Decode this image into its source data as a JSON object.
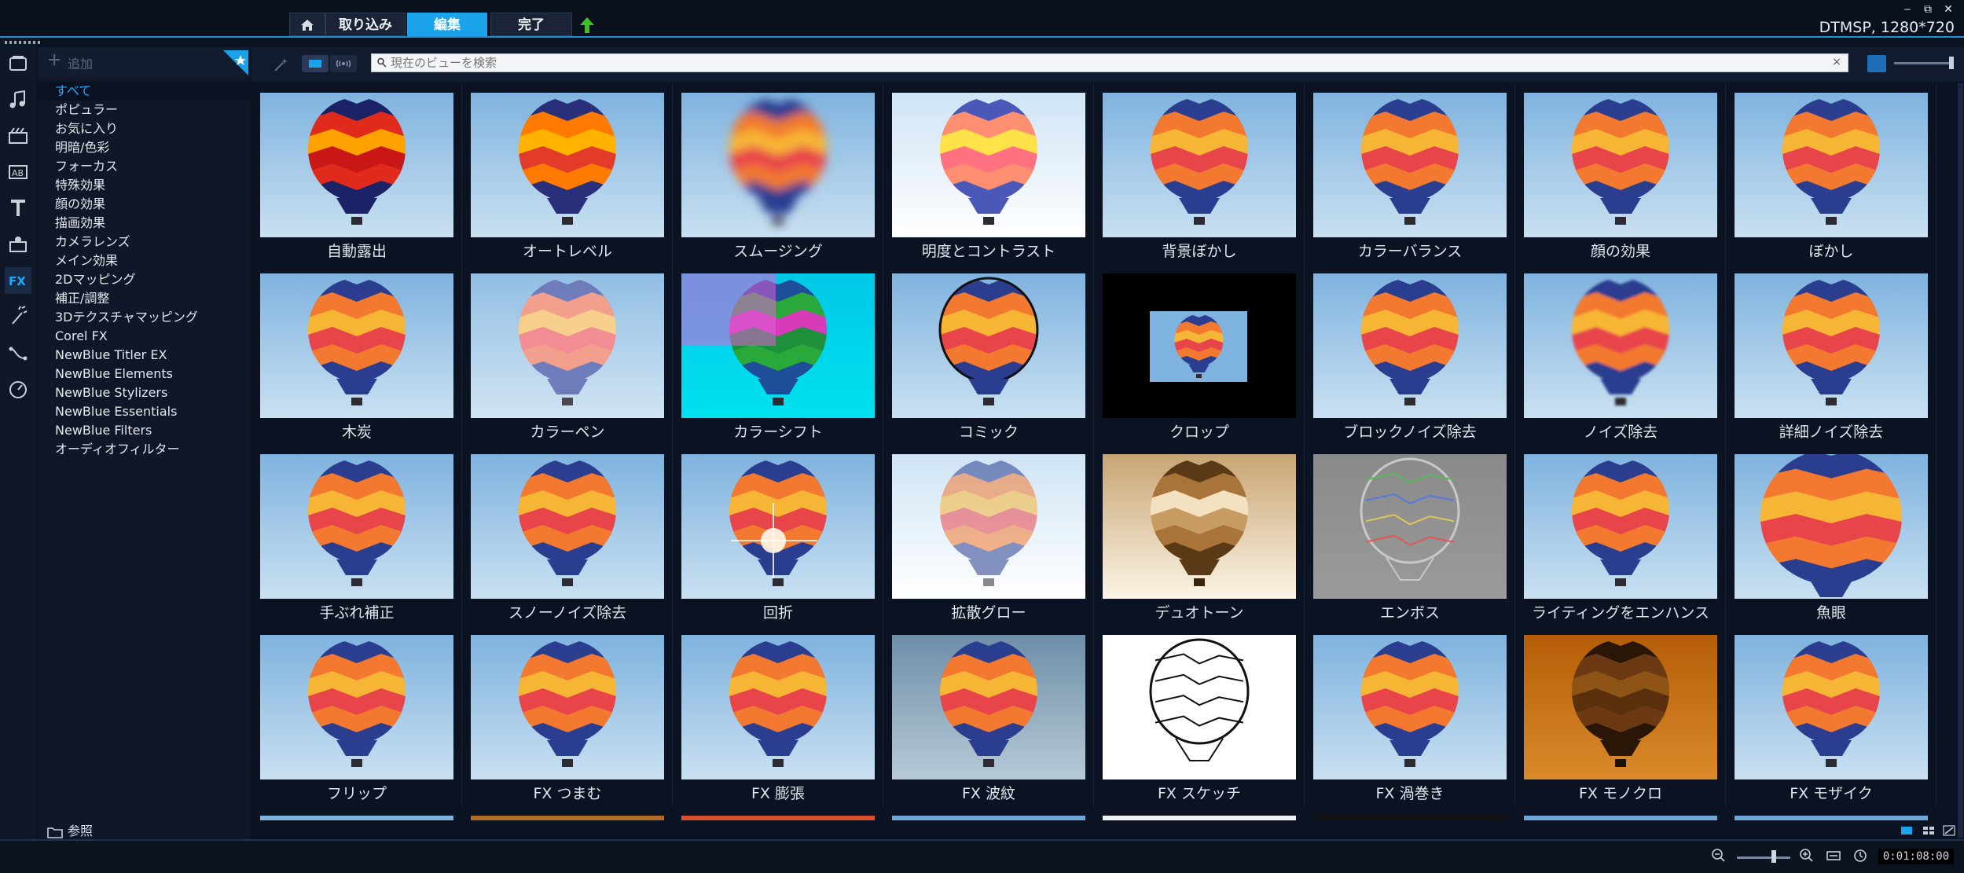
{
  "titlebar": {
    "tabs": [
      {
        "label": "取り込み"
      },
      {
        "label": "編集",
        "active": true
      },
      {
        "label": "完了"
      }
    ],
    "project_info": "DTMSP, 1280*720",
    "window_controls": [
      "‒",
      "⧉",
      "✕"
    ]
  },
  "left_icons": [
    "media-icon",
    "audio-icon",
    "instant-project-icon",
    "transition-icon",
    "title-icon",
    "graphics-icon",
    "fx-icon",
    "motion-icon",
    "path-icon",
    "speed-icon"
  ],
  "category_panel": {
    "add_label": "追加",
    "categories": [
      "すべて",
      "ポピュラー",
      "お気に入り",
      "明暗/色彩",
      "フォーカス",
      "特殊効果",
      "顔の効果",
      "描画効果",
      "カメラレンズ",
      "メイン効果",
      "2Dマッピング",
      "補正/調整",
      "3Dテクスチャマッピング",
      "Corel FX",
      "NewBlue Titler EX",
      "NewBlue Elements",
      "NewBlue Stylizers",
      "NewBlue Essentials",
      "NewBlue Filters",
      "オーディオフィルター"
    ],
    "selected_index": 0,
    "browse_label": "参照"
  },
  "toolbar": {
    "search_placeholder": "現在のビューを検索"
  },
  "effects": [
    {
      "label": "自動露出",
      "style": "vivid"
    },
    {
      "label": "オートレベル",
      "style": "auto"
    },
    {
      "label": "スムージング",
      "style": "blur"
    },
    {
      "label": "明度とコントラスト",
      "style": "bright"
    },
    {
      "label": "背景ぼかし",
      "style": "normal"
    },
    {
      "label": "カラーバランス",
      "style": "normal"
    },
    {
      "label": "顔の効果",
      "style": "normal"
    },
    {
      "label": "ぼかし",
      "style": "normal"
    },
    {
      "label": "木炭",
      "style": "normal"
    },
    {
      "label": "カラーペン",
      "style": "pen"
    },
    {
      "label": "カラーシフト",
      "style": "shift"
    },
    {
      "label": "コミック",
      "style": "comic"
    },
    {
      "label": "クロップ",
      "style": "crop"
    },
    {
      "label": "ブロックノイズ除去",
      "style": "normal"
    },
    {
      "label": "ノイズ除去",
      "style": "soft"
    },
    {
      "label": "詳細ノイズ除去",
      "style": "normal"
    },
    {
      "label": "手ぶれ補正",
      "style": "normal"
    },
    {
      "label": "スノーノイズ除去",
      "style": "normal"
    },
    {
      "label": "回折",
      "style": "flare"
    },
    {
      "label": "拡散グロー",
      "style": "glow"
    },
    {
      "label": "デュオトーン",
      "style": "duotone"
    },
    {
      "label": "エンボス",
      "style": "emboss"
    },
    {
      "label": "ライティングをエンハンス",
      "style": "normal"
    },
    {
      "label": "魚眼",
      "style": "fisheye"
    },
    {
      "label": "フリップ",
      "style": "flip"
    },
    {
      "label": "FX つまむ",
      "style": "normal"
    },
    {
      "label": "FX 膨張",
      "style": "normal"
    },
    {
      "label": "FX 波紋",
      "style": "ripple"
    },
    {
      "label": "FX スケッチ",
      "style": "sketch"
    },
    {
      "label": "FX 渦巻き",
      "style": "normal"
    },
    {
      "label": "FX モノクロ",
      "style": "mono"
    },
    {
      "label": "FX モザイク",
      "style": "normal"
    }
  ],
  "partial_row_colors": [
    "#7fb3df",
    "#b06a2a",
    "#d9502e",
    "#6fa7d6",
    "#eef2f6",
    "#111111",
    "#6fa7d6",
    "#6fa7d6",
    "#6fa7d6"
  ],
  "timecode": "0:01:08:00",
  "colors": {
    "accent": "#1aa3ea",
    "selected_category": "#22a7ff"
  }
}
